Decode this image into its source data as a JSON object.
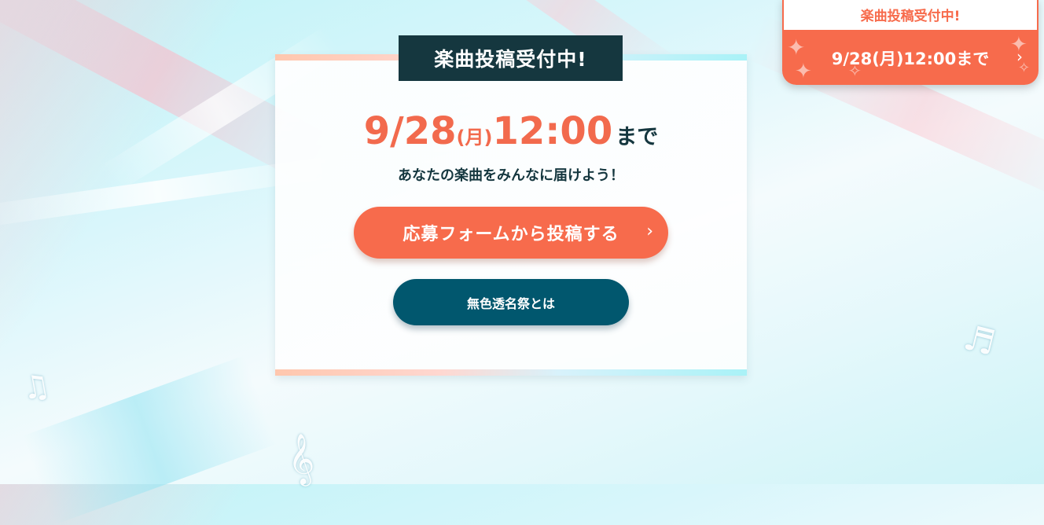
{
  "card": {
    "label": "楽曲投稿受付中!",
    "deadline": {
      "date": "9/28",
      "day_of_week": "(月)",
      "time": "12:00",
      "until": "まで"
    },
    "tagline": "あなたの楽曲をみんなに届けよう！",
    "submit_button": "応募フォームから投稿する",
    "about_button": "無色透名祭とは"
  },
  "corner_banner": {
    "heading": "楽曲投稿受付中!",
    "deadline": "9/28(月)12:00まで"
  },
  "icons": {
    "chevron": "chevron-right-icon",
    "notes": [
      "music-note-icon",
      "double-note-icon",
      "treble-clef-icon"
    ],
    "sparkle": "sparkle-icon"
  },
  "colors": {
    "accent": "#f76b4c",
    "dark": "#15373f",
    "about_button": "#01576e"
  }
}
